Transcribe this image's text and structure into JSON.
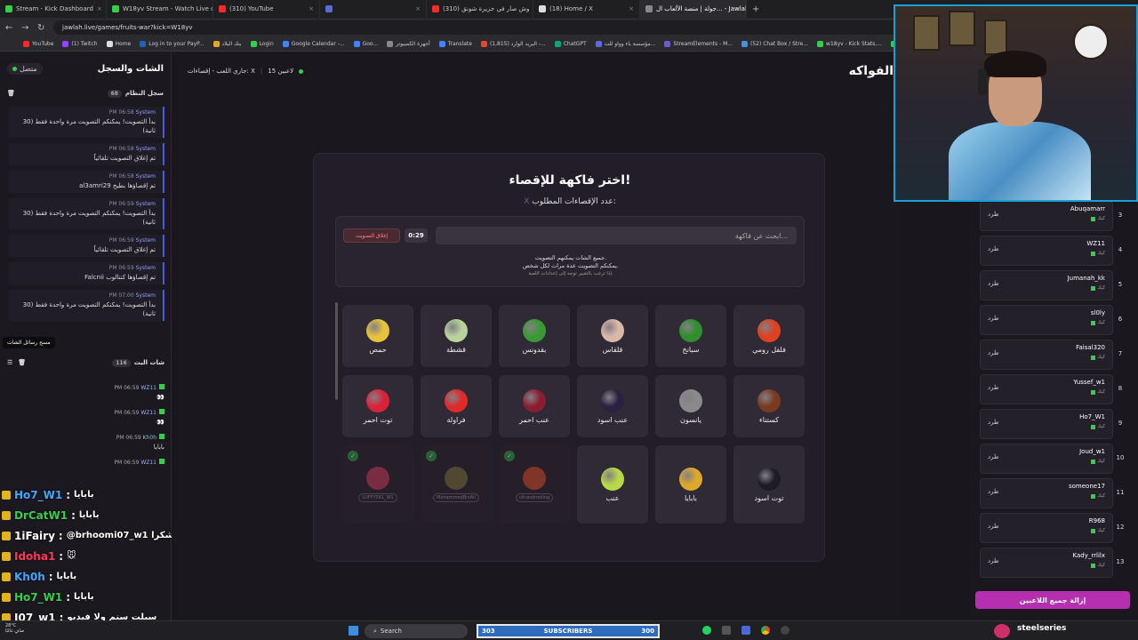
{
  "browser": {
    "tabs": [
      {
        "label": "Stream - Kick Dashboard",
        "color": "#35d04a"
      },
      {
        "label": "W18yv Stream - Watch Live on",
        "color": "#35d04a"
      },
      {
        "label": "(310) YouTube",
        "color": "#ff2a2a"
      },
      {
        "label": "",
        "color": "#5a6bd8"
      },
      {
        "label": "(310) وش صار في جزيرة شونق",
        "color": "#ff2a2a"
      },
      {
        "label": "(18) Home / X",
        "color": "#dddddd"
      },
      {
        "label": "جولة | منصة الألعاب ال... - Jawlah",
        "color": "#888888",
        "active": true
      }
    ],
    "url": "jawlah.live/games/fruits-war?kick=W18yv",
    "bookmarks": [
      "YouTube",
      "(1) Twitch",
      "Home",
      "Log in to your PayP...",
      "بنك البلاد",
      "Login",
      "Google Calendar -...",
      "Goo...",
      "أجهزة الكمبيوتر",
      "Translate",
      "(1,815) البريد الوارد -...",
      "ChatGPT",
      "مؤسسة باء وواو للت...",
      "StreamElements - M...",
      "(52) Chat Box / Stre...",
      "w18yv - Kick Stats,...",
      "Kick",
      "botrix",
      "D"
    ]
  },
  "sidebar": {
    "title": "الشات والسجل",
    "status": "متصل",
    "log_title": "سجل النظام",
    "log_count": "68",
    "log": [
      {
        "time": "PM 06:58",
        "sender": "System",
        "text": "بدأ التصويت! يمكنكم التصويت مرة واحدة فقط (30 ثانية)"
      },
      {
        "time": "PM 06:58",
        "sender": "System",
        "text": "تم إغلاق التصويت تلقائياً"
      },
      {
        "time": "PM 06:58",
        "sender": "System",
        "text": "al3amri29 تم إقصاؤها بطيخ"
      },
      {
        "time": "PM 06:59",
        "sender": "System",
        "text": "بدأ التصويت! يمكنكم التصويت مرة واحدة فقط (30 ثانية)"
      },
      {
        "time": "PM 06:59",
        "sender": "System",
        "text": "تم إغلاق التصويت تلقائياً"
      },
      {
        "time": "PM 06:59",
        "sender": "System",
        "text": "Falcnii تم إقصاؤها كنتالوب"
      },
      {
        "time": "PM 07:00",
        "sender": "System",
        "text": "بدأ التصويت! يمكنكم التصويت مرة واحدة فقط (30 ثانية)"
      }
    ],
    "tooltip": "مسح رسائل الشات",
    "bot_title": "شات البث",
    "bot_count": "116",
    "bot_chat": [
      {
        "time": "PM 06:59",
        "user": "WZ11",
        "text": "👀"
      },
      {
        "time": "PM 06:59",
        "user": "WZ11",
        "text": "👀"
      },
      {
        "time": "PM 06:59",
        "user": "Kh0h",
        "text": "بابايا"
      },
      {
        "time": "PM 06:59",
        "user": "WZ11",
        "text": ""
      }
    ]
  },
  "overlay_chat": [
    {
      "user": "Ho7_W1",
      "text": "بابايا",
      "color": "#3fa9ff"
    },
    {
      "user": "DrCatW1",
      "text": "بابايا",
      "color": "#35d04a"
    },
    {
      "user": "1iFairy",
      "text": "@brhoomi07_w1 شكرا",
      "color": "#ffffff"
    },
    {
      "user": "Idoha1",
      "text": "🐭",
      "color": "#ff3a5a"
    },
    {
      "user": "Kh0h",
      "text": "بابايا",
      "color": "#3fa9ff"
    },
    {
      "user": "Ho7_W1",
      "text": "بابايا",
      "color": "#35d04a"
    },
    {
      "user": "I07_w1",
      "text": "سبلت سنم ولا فيديو",
      "color": "#ffffff"
    }
  ],
  "main": {
    "status": "جاري اللعب - إقصاءات: X",
    "players_online": "15 لاعبين",
    "game_title": "الفواكه",
    "card_title": "اختر فاكهة للإقصاء!",
    "card_sub": "عدد الإقصاءات المطلوب:",
    "card_sub_value": "X",
    "search_placeholder": "ابحث عن فاكهة...",
    "timer": "0:29",
    "close_vote": "إغلاق التصويت",
    "info_line1": "جميع الشات يمكنهم التصويت.",
    "info_line2": "يمكنكم التصويت عدة مرات لكل شخص.",
    "info_tip": "إذا ترغب بالتغيير توجه إلى إعدادات اللعبة.",
    "fruits": [
      {
        "name": "فلفل رومي",
        "color": "#e0401e"
      },
      {
        "name": "سبانخ",
        "color": "#2f8f2a"
      },
      {
        "name": "قلقاس",
        "color": "#d9b8a8"
      },
      {
        "name": "بقدونس",
        "color": "#3a9a32"
      },
      {
        "name": "قشطة",
        "color": "#b8d49a"
      },
      {
        "name": "حمص",
        "color": "#e8c33a"
      },
      {
        "name": "كستناء",
        "color": "#7a3a1e"
      },
      {
        "name": "يانسون",
        "color": "#8a8a8a"
      },
      {
        "name": "عنب اسود",
        "color": "#2a2040"
      },
      {
        "name": "عنب احمر",
        "color": "#8a1e30"
      },
      {
        "name": "فراولة",
        "color": "#e02a2a"
      },
      {
        "name": "توت احمر",
        "color": "#d8223a"
      },
      {
        "name": "توت اسود",
        "color": "#1e1a26"
      },
      {
        "name": "بابايا",
        "color": "#e0a82a"
      },
      {
        "name": "عنب",
        "color": "#b8d84a"
      }
    ],
    "eliminated": [
      {
        "name": "ultrasdrooling",
        "color": "#d04a2a"
      },
      {
        "name": "MohammedBinAli",
        "color": "#7a6a3a"
      },
      {
        "name": "LUFFY561_W1",
        "color": "#c03a5a"
      }
    ]
  },
  "players": [
    {
      "rank": "3",
      "name": "Abuqamarr",
      "sub": "كيك",
      "kick": "طرد"
    },
    {
      "rank": "4",
      "name": "WZ11",
      "sub": "كيك",
      "kick": "طرد"
    },
    {
      "rank": "5",
      "name": "Jumanah_kk",
      "sub": "كيك",
      "kick": "طرد"
    },
    {
      "rank": "6",
      "name": "sl0ly",
      "sub": "كيك",
      "kick": "طرد"
    },
    {
      "rank": "7",
      "name": "Faisal320",
      "sub": "كيك",
      "kick": "طرد"
    },
    {
      "rank": "8",
      "name": "Yussef_w1",
      "sub": "كيك",
      "kick": "طرد"
    },
    {
      "rank": "9",
      "name": "Ho7_W1",
      "sub": "كيك",
      "kick": "طرد"
    },
    {
      "rank": "10",
      "name": "Joud_w1",
      "sub": "كيك",
      "kick": "طرد"
    },
    {
      "rank": "11",
      "name": "someone17",
      "sub": "كيك",
      "kick": "طرد"
    },
    {
      "rank": "12",
      "name": "R968",
      "sub": "كيك",
      "kick": "طرد"
    },
    {
      "rank": "13",
      "name": "Kady_rrlilx",
      "sub": "كيك",
      "kick": "طرد"
    }
  ],
  "remove_all": "إزالة جميع اللاعبين",
  "taskbar": {
    "weather_temp": "28°C",
    "weather_text": "صافٍ غالبًا",
    "search": "Search",
    "sub_current": "303",
    "sub_label": "SUBSCRIBERS",
    "sub_goal": "300",
    "sub_progress": 1.0,
    "brand": "steelseries"
  }
}
